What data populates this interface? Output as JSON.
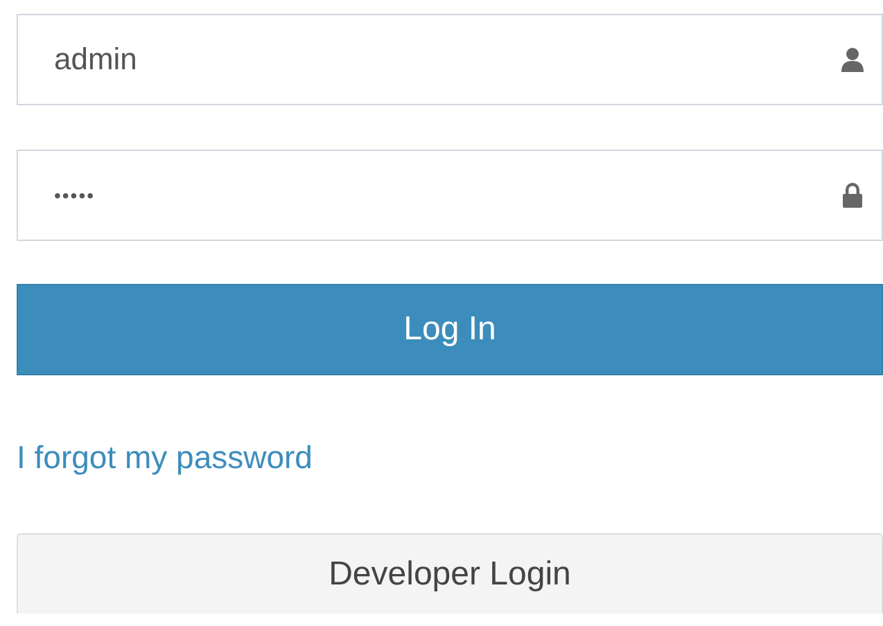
{
  "fields": [
    {
      "kind": "username",
      "value": "admin"
    },
    {
      "kind": "password",
      "value": "•••••"
    }
  ],
  "login_button": "Log In",
  "forgot_link": "I forgot my password",
  "developer_button": "Developer Login"
}
